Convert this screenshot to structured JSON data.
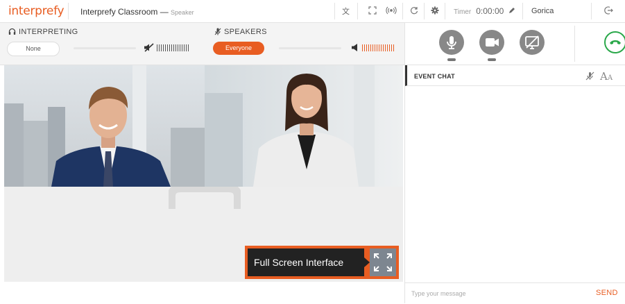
{
  "app": {
    "logo": "interprefy",
    "classroom_title": "Interprefy Classroom —",
    "role": "Speaker"
  },
  "toolbar": {
    "translate_icon": "translate-icon",
    "fullscreen_icon": "expand-icon",
    "broadcast_icon": "broadcast-icon",
    "refresh_icon": "refresh-icon",
    "settings_icon": "gear-icon",
    "timer_label": "Timer",
    "timer_value": "0:00:00",
    "user": "Gorica"
  },
  "interpreting": {
    "title": "INTERPRETING",
    "selected": "None",
    "volume_level": 0.0
  },
  "speakers": {
    "title": "SPEAKERS",
    "selected": "Everyone",
    "volume_level": 1.0
  },
  "media_controls": {
    "mic": "microphone-icon",
    "camera": "camera-icon",
    "screenshare": "screenshare-off-icon",
    "hangup": "hangup-icon"
  },
  "stage": {
    "participants": [
      {
        "name": "participant-male"
      },
      {
        "name": "participant-female"
      }
    ],
    "fullscreen_label": "Full Screen Interface"
  },
  "chat": {
    "title": "EVENT CHAT",
    "placeholder": "Type your message",
    "send_label": "SEND"
  },
  "colors": {
    "accent": "#e85d22",
    "hangup": "#2aa84a",
    "icon_gray": "#888888"
  }
}
